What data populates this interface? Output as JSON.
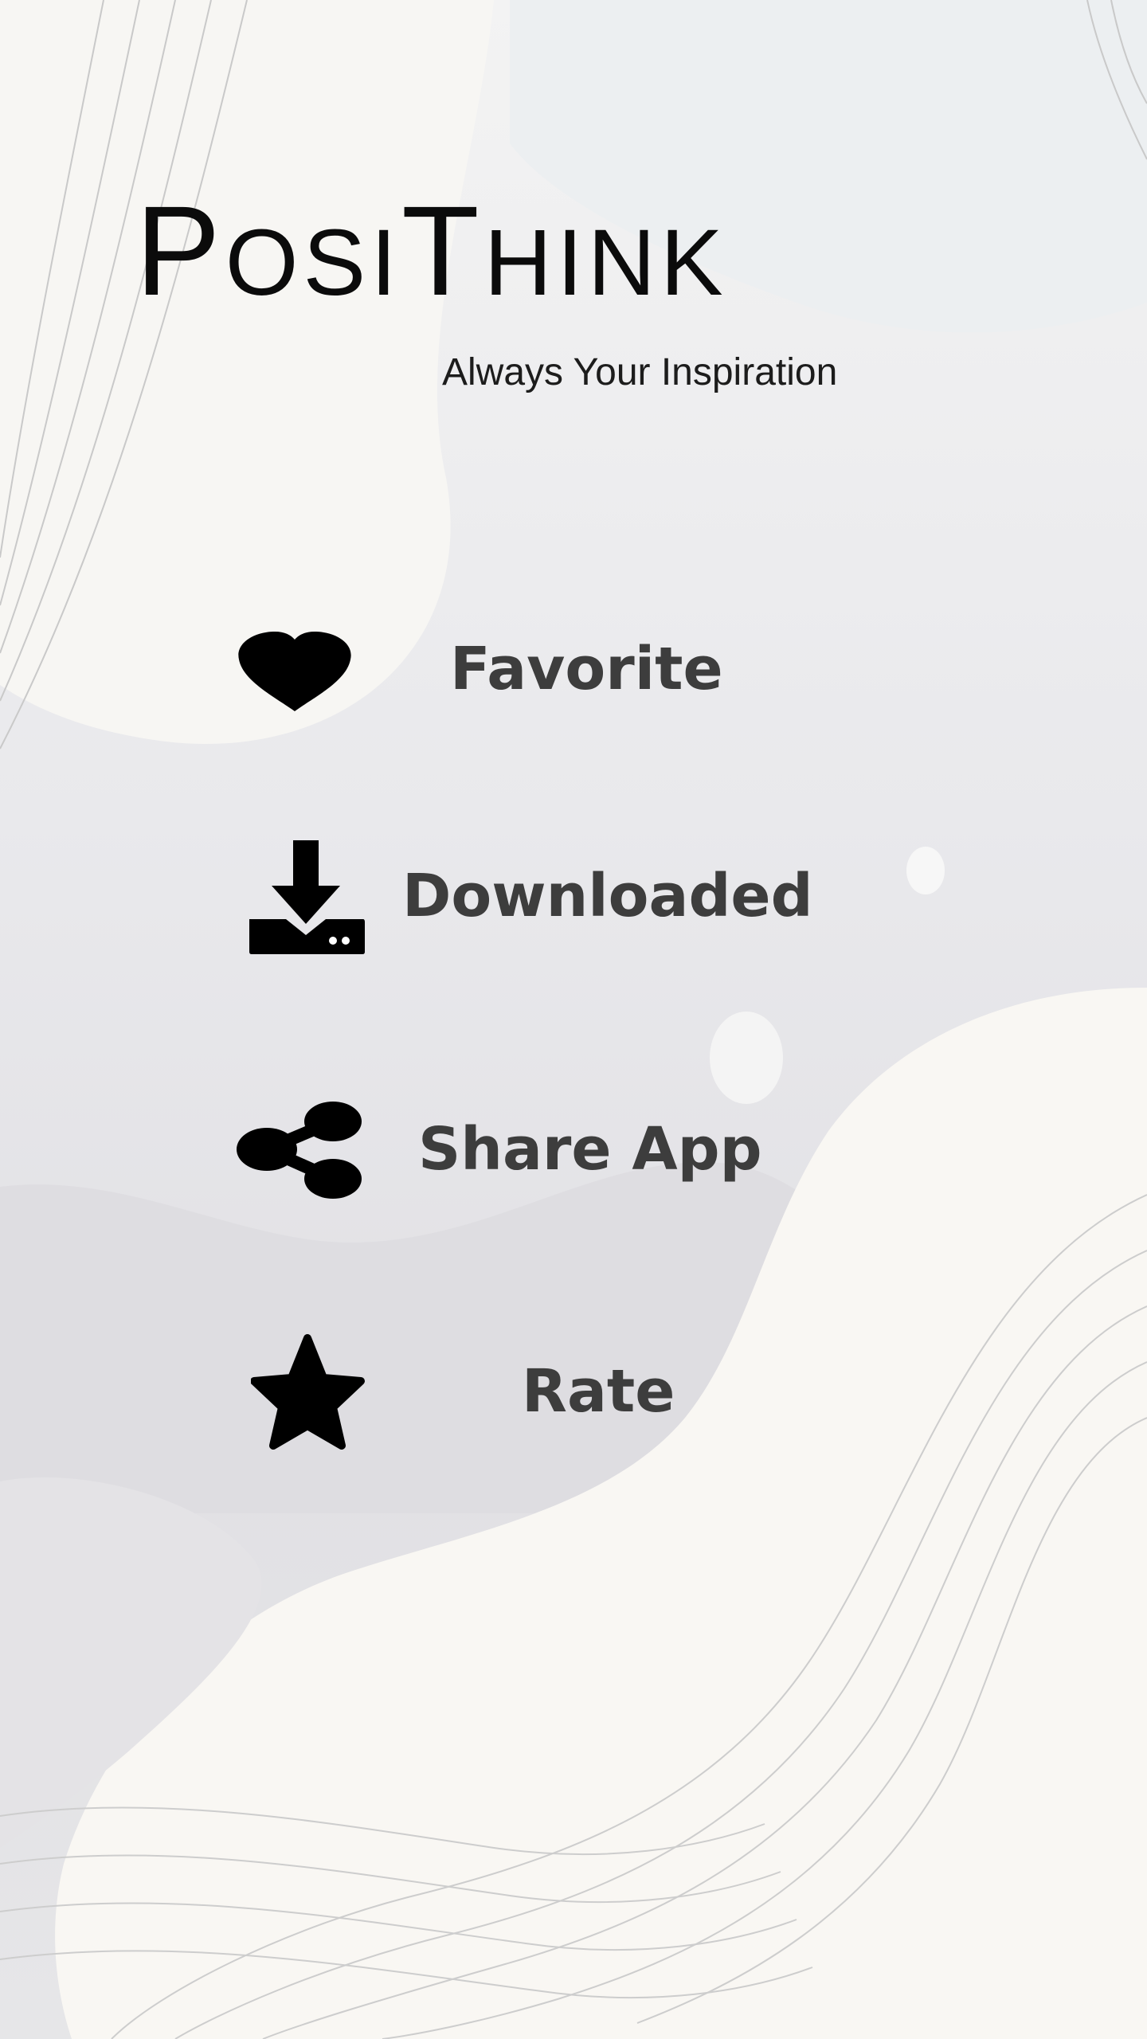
{
  "app": {
    "title_parts": [
      "P",
      "OSI",
      "T",
      "HINK"
    ],
    "tagline": "Always Your Inspiration"
  },
  "menu": {
    "items": [
      {
        "label": "Favorite",
        "icon": "heart-icon"
      },
      {
        "label": "Downloaded",
        "icon": "download-icon"
      },
      {
        "label": "Share App",
        "icon": "share-icon"
      },
      {
        "label": "Rate",
        "icon": "star-icon"
      }
    ]
  },
  "colors": {
    "icon": "#000000",
    "label": "#3d3d3d",
    "title": "#0b0b0b",
    "background": "#e8e8ea"
  }
}
